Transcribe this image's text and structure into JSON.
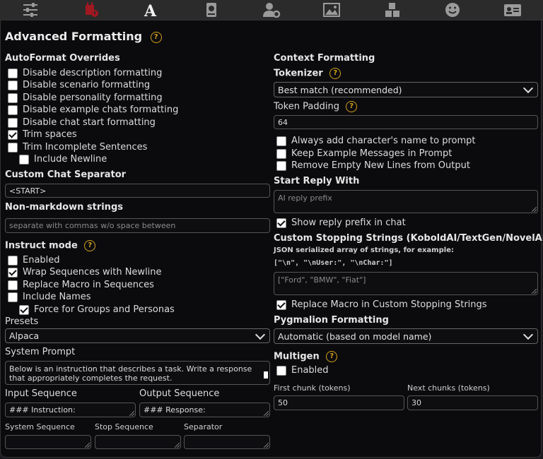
{
  "topbar": {
    "icons": [
      "sliders-icon",
      "plug-icon",
      "font-a-icon",
      "book-globe-icon",
      "user-gear-icon",
      "image-icon",
      "cubes-icon",
      "smiley-icon",
      "id-card-icon"
    ]
  },
  "title": "Advanced Formatting",
  "help_glyph": "?",
  "left": {
    "autoformat_title": "AutoFormat Overrides",
    "autoformat": [
      {
        "label": "Disable description formatting",
        "checked": false
      },
      {
        "label": "Disable scenario formatting",
        "checked": false
      },
      {
        "label": "Disable personality formatting",
        "checked": false
      },
      {
        "label": "Disable example chats formatting",
        "checked": false
      },
      {
        "label": "Disable chat start formatting",
        "checked": false
      },
      {
        "label": "Trim spaces",
        "checked": true
      },
      {
        "label": "Trim Incomplete Sentences",
        "checked": false
      },
      {
        "label": "Include Newline",
        "checked": false
      }
    ],
    "separator_title": "Custom Chat Separator",
    "separator_value": "<START>",
    "nonmd_title": "Non-markdown strings",
    "nonmd_placeholder": "separate with commas w/o space between",
    "instruct_title": "Instruct mode",
    "instruct": [
      {
        "label": "Enabled",
        "checked": false
      },
      {
        "label": "Wrap Sequences with Newline",
        "checked": true
      },
      {
        "label": "Replace Macro in Sequences",
        "checked": false
      },
      {
        "label": "Include Names",
        "checked": false
      },
      {
        "label": "Force for Groups and Personas",
        "checked": true
      }
    ],
    "presets_label": "Presets",
    "presets_value": "Alpaca",
    "system_prompt_label": "System Prompt",
    "system_prompt_value": "Below is an instruction that describes a task. Write a response that appropriately completes the request.",
    "input_seq_label": "Input Sequence",
    "input_seq_value": "### Instruction:",
    "output_seq_label": "Output Sequence",
    "output_seq_value": "### Response:",
    "system_seq_label": "System Sequence",
    "stop_seq_label": "Stop Sequence",
    "separator_label": "Separator"
  },
  "right": {
    "context_title": "Context Formatting",
    "tokenizer_title": "Tokenizer",
    "tokenizer_value": "Best match (recommended)",
    "padding_label": "Token Padding",
    "padding_value": "64",
    "context_opts": [
      {
        "label": "Always add character's name to prompt",
        "checked": false
      },
      {
        "label": "Keep Example Messages in Prompt",
        "checked": false
      },
      {
        "label": "Remove Empty New Lines from Output",
        "checked": false
      }
    ],
    "start_reply_title": "Start Reply With",
    "start_reply_placeholder": "AI reply prefix",
    "show_prefix_label": "Show reply prefix in chat",
    "show_prefix_checked": true,
    "stopping_title": "Custom Stopping Strings (KoboldAI/TextGen/NovelAI)",
    "stopping_hint": "JSON serialized array of strings, for example:",
    "stopping_example": "[\"\\n\", \"\\nUser:\", \"\\nChar:\"]",
    "stopping_placeholder": "[\"Ford\", \"BMW\", \"Fiat\"]",
    "replace_macro_label": "Replace Macro in Custom Stopping Strings",
    "replace_macro_checked": true,
    "pyg_title": "Pygmalion Formatting",
    "pyg_value": "Automatic (based on model name)",
    "multigen_title": "Multigen",
    "multigen_enabled_label": "Enabled",
    "multigen_enabled_checked": false,
    "first_chunk_label": "First chunk (tokens)",
    "first_chunk_value": "50",
    "next_chunks_label": "Next chunks (tokens)",
    "next_chunks_value": "30"
  }
}
